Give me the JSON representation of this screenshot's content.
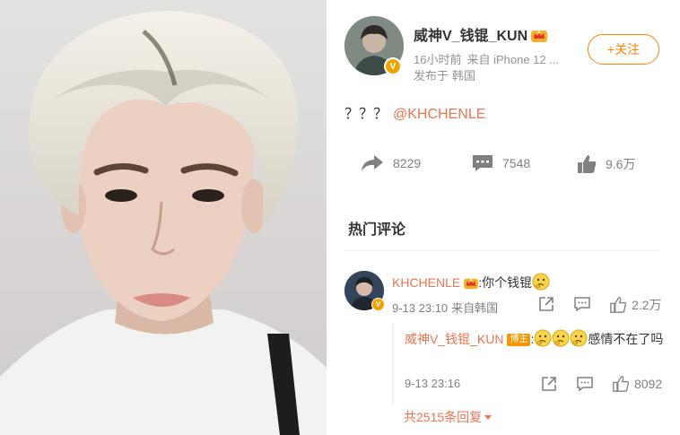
{
  "post": {
    "author": "威神V_钱锟_KUN",
    "time": "16小时前",
    "source": "来自 iPhone 12 ...",
    "location_prefix": "发布于",
    "location": "韩国",
    "follow_label": "+关注",
    "text": "？？？",
    "mention": "@KHCHENLE",
    "repost_count": "8229",
    "comment_count": "7548",
    "like_count": "9.6万"
  },
  "hot_comments": {
    "title": "热门评论",
    "comment": {
      "user": "KHCHENLE",
      "text": ":你个钱锟",
      "time": "9-13 23:10",
      "source": "来自韩国",
      "likes": "2.2万"
    },
    "reply": {
      "user": "威神V_钱锟_KUN",
      "tag": "博主",
      "text": "感情不在了吗",
      "time": "9-13 23:16",
      "likes": "8092"
    },
    "more_label": "共2515条回复"
  },
  "icons": {
    "repost": "repost-icon",
    "comment": "comment-icon",
    "like": "thumbs-up-icon",
    "share": "share-icon",
    "verified": "verified-v-icon",
    "membership": "crown-icon",
    "emoji": "thinking-face-emoji"
  },
  "colors": {
    "accent": "#ff8200",
    "link": "#eb7350",
    "meta": "#939393",
    "verified": "#f0a300"
  }
}
